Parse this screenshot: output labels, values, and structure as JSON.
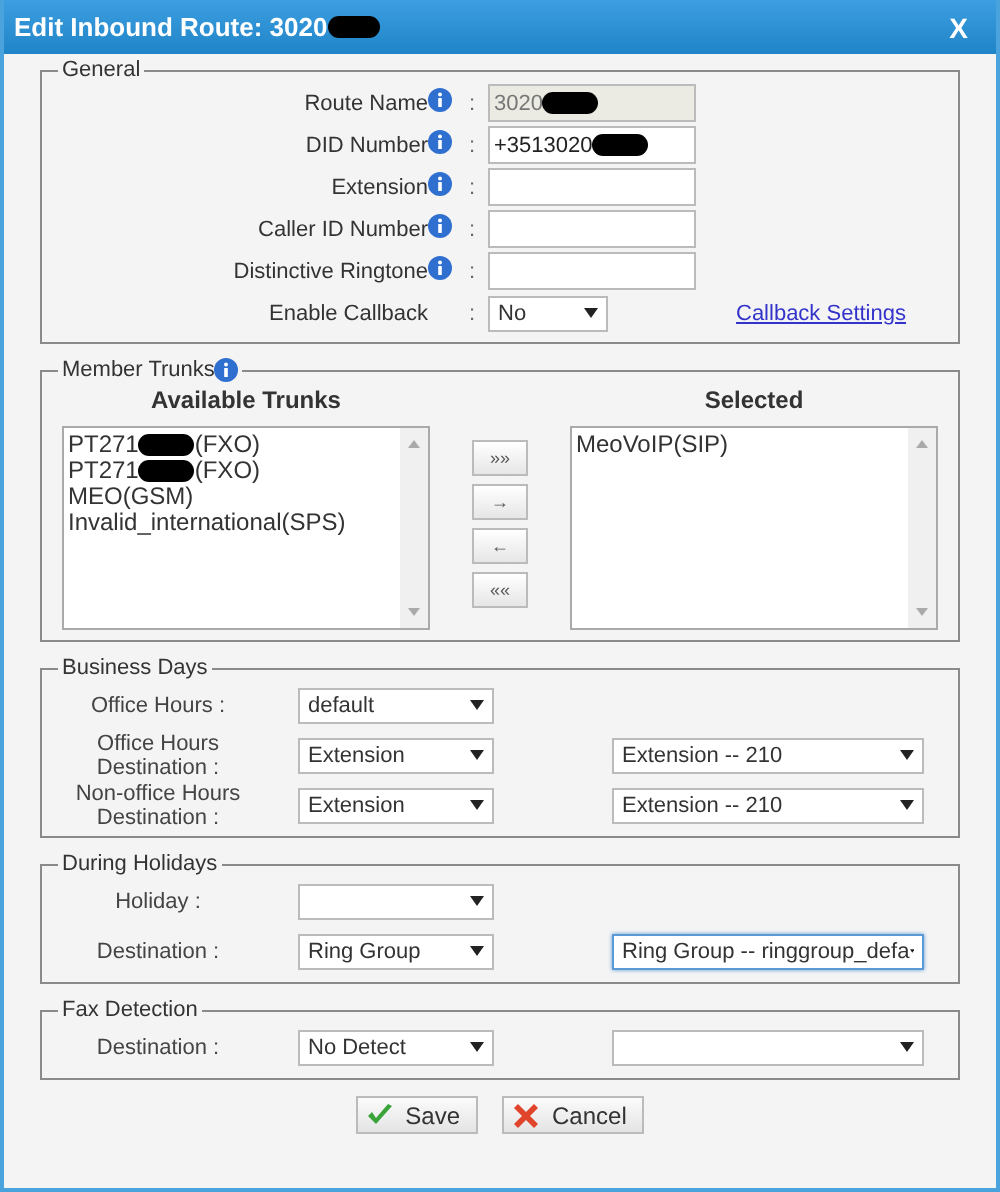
{
  "window": {
    "title": "Edit Inbound Route: 3020",
    "title_redacted": true,
    "close": "X"
  },
  "general": {
    "title": "General",
    "fields": [
      {
        "kind": "text",
        "label": "Route Name",
        "info": true,
        "colon": ":",
        "value": "3020",
        "redacted": true,
        "disabled": true
      },
      {
        "kind": "text",
        "label": "DID Number",
        "info": true,
        "colon": ":",
        "value": "+3513020",
        "redacted": true,
        "disabled": false
      },
      {
        "kind": "text",
        "label": "Extension",
        "info": true,
        "colon": ":",
        "redacted": false,
        "disabled": false
      },
      {
        "kind": "text",
        "label": "Caller ID Number",
        "info": true,
        "colon": ":",
        "redacted": false,
        "disabled": false
      },
      {
        "kind": "text",
        "label": "Distinctive Ringtone",
        "info": true,
        "colon": ":",
        "redacted": false,
        "disabled": false
      },
      {
        "kind": "select",
        "label": "Enable Callback",
        "info": false,
        "colon": ":",
        "value": "No",
        "link": "Callback Settings"
      }
    ]
  },
  "trunks": {
    "title": "Member Trunks",
    "info": true,
    "available": {
      "heading": "Available Trunks",
      "items": [
        {
          "text": "PT271",
          "suffix": "(FXO)",
          "redacted": true
        },
        {
          "text": "PT271",
          "suffix": "(FXO)",
          "redacted": true
        },
        {
          "text": "MEO(GSM)",
          "redacted": false
        },
        {
          "text": "Invalid_international(SPS)",
          "redacted": false
        }
      ]
    },
    "buttons": [
      "»»",
      "→",
      "←",
      "««"
    ],
    "selected": {
      "heading": "Selected",
      "items": [
        {
          "text": "MeoVoIP(SIP)",
          "redacted": false
        }
      ]
    }
  },
  "sections": [
    {
      "title": "Business Days",
      "rows": [
        {
          "label": "Office Hours :",
          "selects": [
            {
              "value": "default",
              "focused": false
            }
          ]
        },
        {
          "label": "Office Hours Destination :",
          "selects": [
            {
              "value": "Extension",
              "focused": false
            },
            {
              "value": "Extension -- 210",
              "focused": false
            }
          ]
        },
        {
          "label": "Non-office Hours Destination :",
          "selects": [
            {
              "value": "Extension",
              "focused": false
            },
            {
              "value": "Extension -- 210",
              "focused": false
            }
          ]
        }
      ]
    },
    {
      "title": "During Holidays",
      "rows": [
        {
          "label": "Holiday :",
          "selects": [
            {
              "focused": false
            }
          ]
        },
        {
          "label": "Destination :",
          "selects": [
            {
              "value": "Ring Group",
              "focused": false
            },
            {
              "value": "Ring Group -- ringgroup_defa",
              "focused": true
            }
          ]
        }
      ]
    },
    {
      "title": "Fax Detection",
      "rows": [
        {
          "label": "Destination :",
          "selects": [
            {
              "value": "No Detect",
              "focused": false
            },
            {
              "focused": false
            }
          ]
        }
      ]
    }
  ],
  "actions": [
    {
      "kind": "save",
      "label": "Save"
    },
    {
      "kind": "cancel",
      "label": "Cancel"
    }
  ]
}
